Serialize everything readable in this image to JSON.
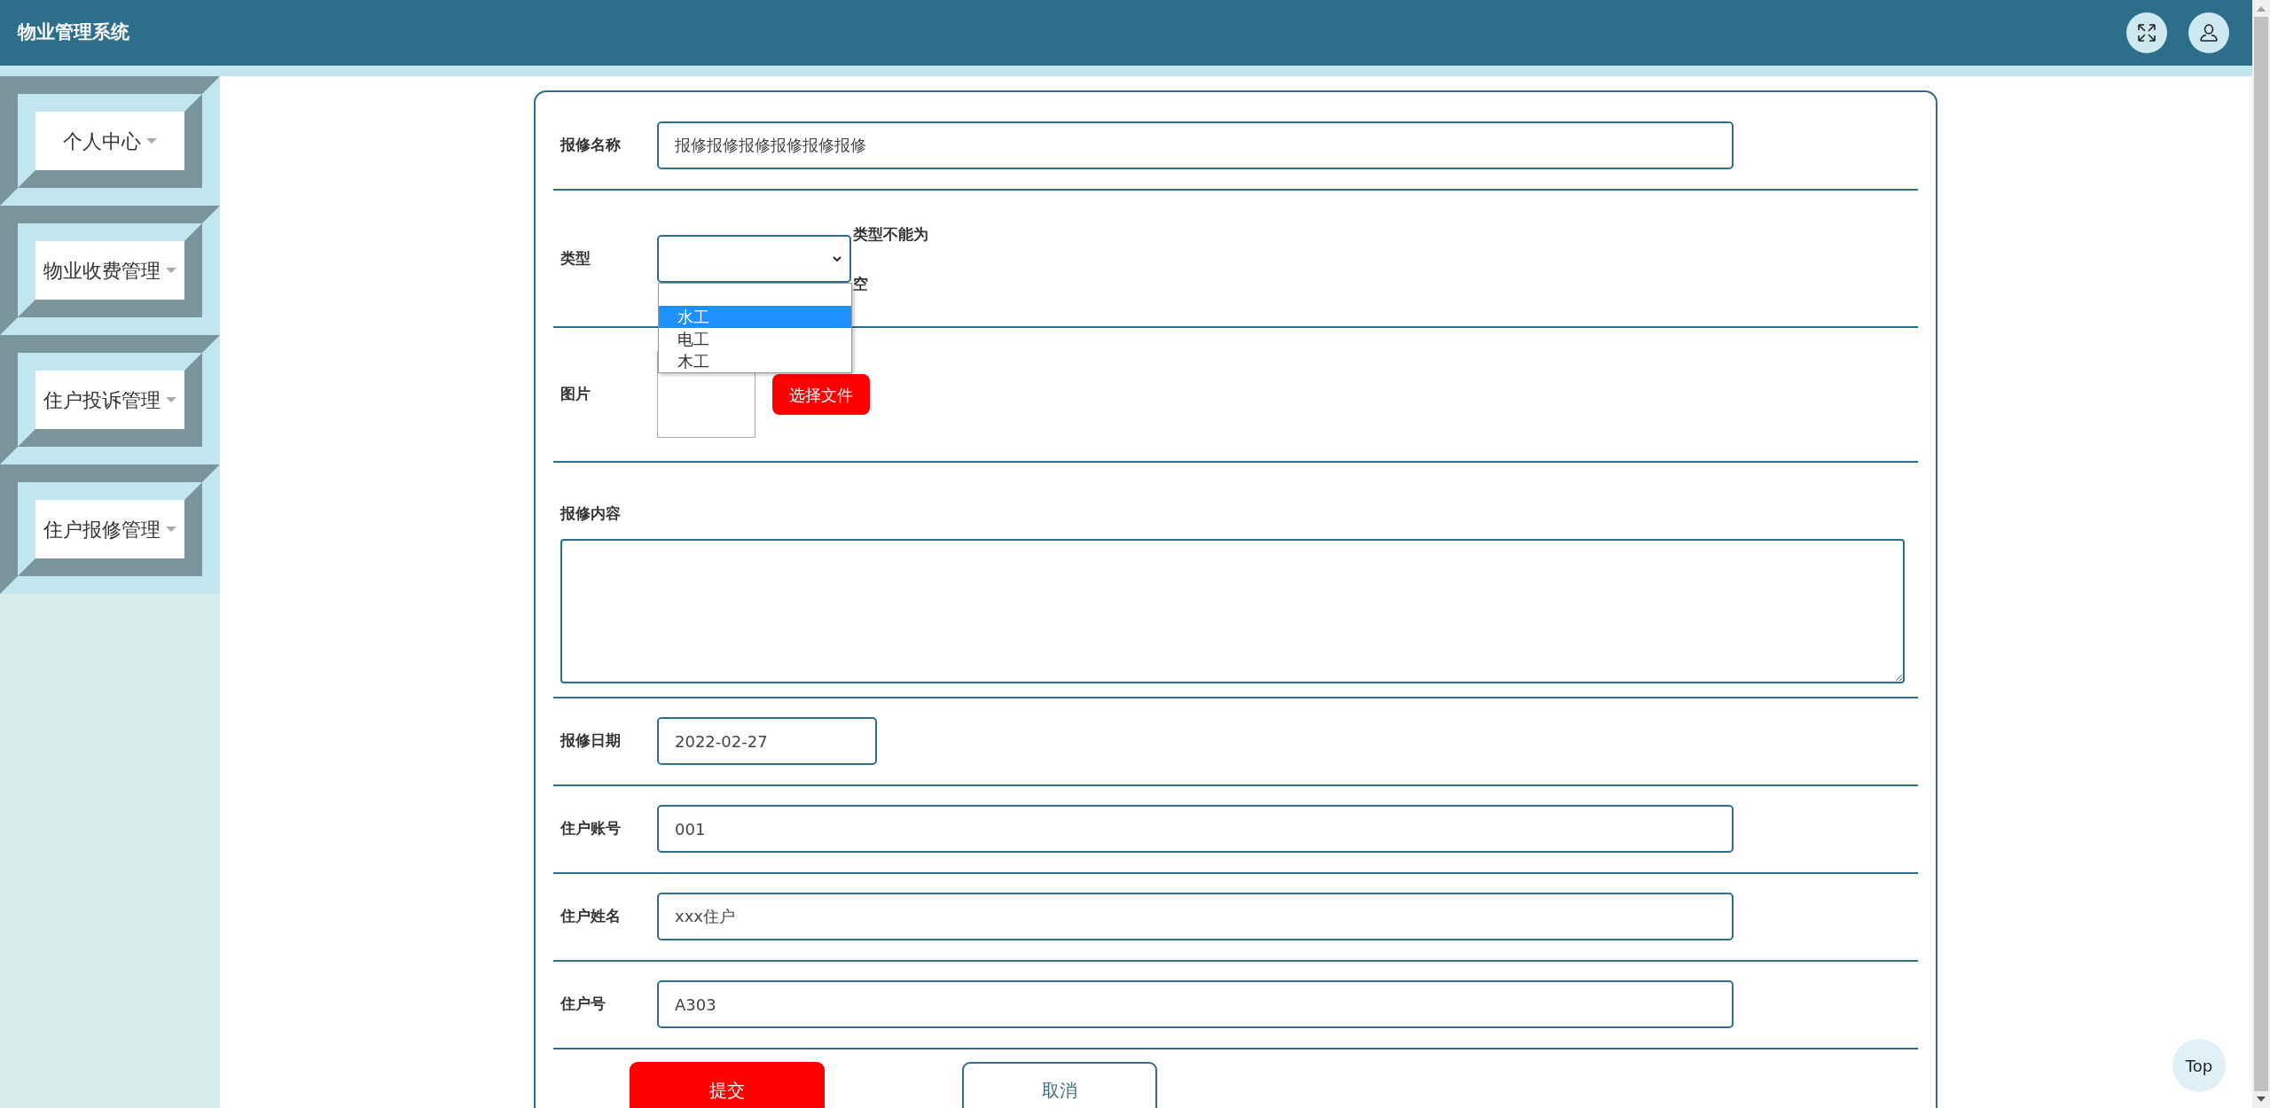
{
  "header": {
    "title": "物业管理系统"
  },
  "sidebar": {
    "items": [
      {
        "label": "个人中心"
      },
      {
        "label": "物业收费管理"
      },
      {
        "label": "住户投诉管理"
      },
      {
        "label": "住户报修管理"
      }
    ]
  },
  "form": {
    "fields": [
      {
        "kind": "text",
        "label": "报修名称",
        "value": "报修报修报修报修报修报修"
      },
      {
        "kind": "select",
        "label": "类型",
        "error": "类型不能为空",
        "expanded": true,
        "options": [
          {
            "label": "水工",
            "selected": true
          },
          {
            "label": "电工",
            "selected": false
          },
          {
            "label": "木工",
            "selected": false
          }
        ]
      },
      {
        "kind": "file",
        "label": "图片",
        "button": "选择文件"
      },
      {
        "kind": "textarea",
        "label": "报修内容"
      },
      {
        "kind": "date",
        "label": "报修日期",
        "value": "2022-02-27"
      },
      {
        "kind": "text",
        "label": "住户账号",
        "value": "001"
      },
      {
        "kind": "text",
        "label": "住户姓名",
        "value": "xxx住户"
      },
      {
        "kind": "text",
        "label": "住户号",
        "value": "A303"
      }
    ],
    "buttons": [
      {
        "label": "提交",
        "kind": "primary"
      },
      {
        "label": "取消",
        "kind": "outline"
      }
    ]
  },
  "top_button": {
    "label": "Top"
  }
}
